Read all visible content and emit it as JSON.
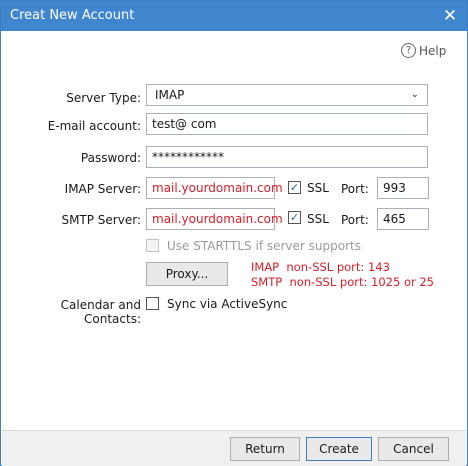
{
  "window": {
    "title": "Creat New Account",
    "close_glyph": "✕"
  },
  "help": {
    "icon": "?",
    "label": "Help"
  },
  "server_type": {
    "label": "Server Type:",
    "value": "IMAP",
    "arrow": "⌄"
  },
  "email": {
    "label": "E-mail account:",
    "value": "test@                 com"
  },
  "password": {
    "label": "Password:",
    "value": "************"
  },
  "imap": {
    "label": "IMAP Server:",
    "value": "mail.yourdomain.com",
    "ssl_label": "SSL",
    "ssl_checked": true,
    "port_label": "Port:",
    "port": "993"
  },
  "smtp": {
    "label": "SMTP Server:",
    "value": "mail.yourdomain.com",
    "ssl_label": "SSL",
    "ssl_checked": true,
    "port_label": "Port:",
    "port": "465"
  },
  "starttls": {
    "label": "Use STARTTLS if server supports",
    "checked": false,
    "enabled": false
  },
  "proxy": {
    "label": "Proxy..."
  },
  "port_notes": [
    "IMAP  non-SSL port: 143",
    "SMTP  non-SSL port: 1025 or 25"
  ],
  "calendar": {
    "label": "Calendar and Contacts:",
    "sync_label": "Sync via ActiveSync",
    "checked": false
  },
  "buttons": {
    "return": "Return",
    "create": "Create",
    "cancel": "Cancel"
  },
  "colors": {
    "titlebar": "#3f86cf",
    "highlight_text": "#d0202a",
    "check": "#1a63b5"
  }
}
